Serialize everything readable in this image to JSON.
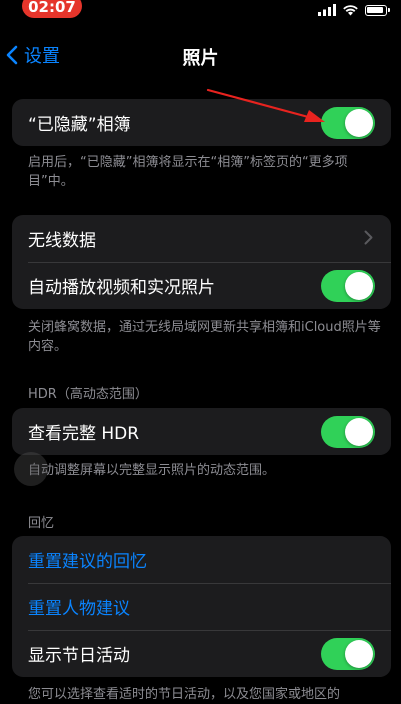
{
  "status_bar": {
    "time": "02:07"
  },
  "nav": {
    "back_label": "设置",
    "title": "照片"
  },
  "group1": {
    "hidden_album": {
      "label": "“已隐藏”相簿",
      "toggle_on": true
    },
    "footnote": "启用后，“已隐藏”相簿将显示在“相簿”标签页的“更多项目”中。"
  },
  "group2": {
    "wireless_data": {
      "label": "无线数据"
    },
    "autoplay": {
      "label": "自动播放视频和实况照片",
      "toggle_on": true
    },
    "footnote": "关闭蜂窝数据，通过无线局域网更新共享相簿和iCloud照片等内容。"
  },
  "hdr_section": {
    "header": "HDR（高动态范围）",
    "view_full_hdr": {
      "label": "查看完整 HDR",
      "toggle_on": true
    },
    "footnote": "自动调整屏幕以完整显示照片的动态范围。"
  },
  "memories_section": {
    "header": "回忆",
    "reset_memories": "重置建议的回忆",
    "reset_people": "重置人物建议",
    "holiday_events": {
      "label": "显示节日活动",
      "toggle_on": true
    },
    "footnote": "您可以选择查看适时的节日活动，以及您国家或地区的"
  },
  "colors": {
    "accent": "#0a84ff",
    "toggle_on": "#30d158",
    "annotation_arrow": "#e8231f"
  }
}
